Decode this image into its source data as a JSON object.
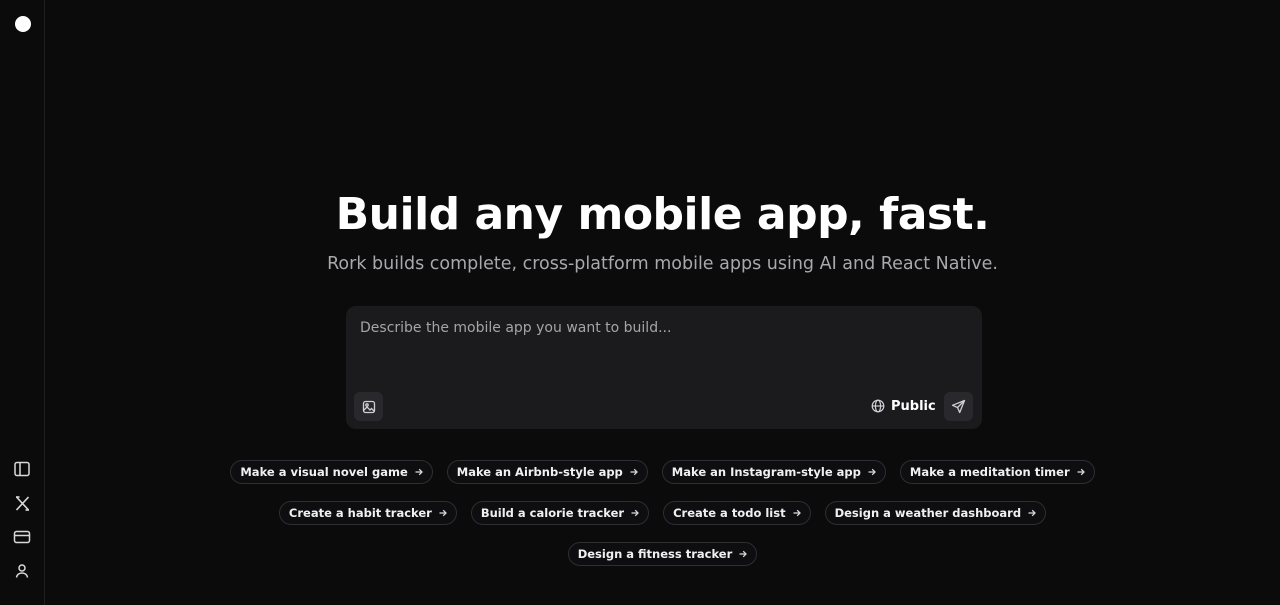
{
  "sidebar": {
    "logo": "circle-logo",
    "icons": [
      {
        "name": "sidebar-toggle-icon"
      },
      {
        "name": "x-twitter-icon"
      },
      {
        "name": "credit-card-icon"
      },
      {
        "name": "user-icon"
      }
    ]
  },
  "hero": {
    "title": "Build any mobile app, fast.",
    "subtitle": "Rork builds complete, cross-platform mobile apps using AI and React Native."
  },
  "prompt": {
    "placeholder": "Describe the mobile app you want to build...",
    "value": "",
    "visibility_label": "Public",
    "attach_icon": "image-icon",
    "globe_icon": "globe-icon",
    "send_icon": "send-icon"
  },
  "suggestions": {
    "row1": [
      "Make a visual novel game",
      "Make an Airbnb-style app",
      "Make an Instagram-style app",
      "Make a meditation timer"
    ],
    "row2": [
      "Create a habit tracker",
      "Build a calorie tracker",
      "Create a todo list",
      "Design a weather dashboard"
    ],
    "row3": [
      "Design a fitness tracker"
    ]
  },
  "colors": {
    "background": "#0b0b0c",
    "panel": "#1b1b1e",
    "text": "#ffffff",
    "muted": "#a8a8ad",
    "chip_border": "#2e2e33"
  }
}
